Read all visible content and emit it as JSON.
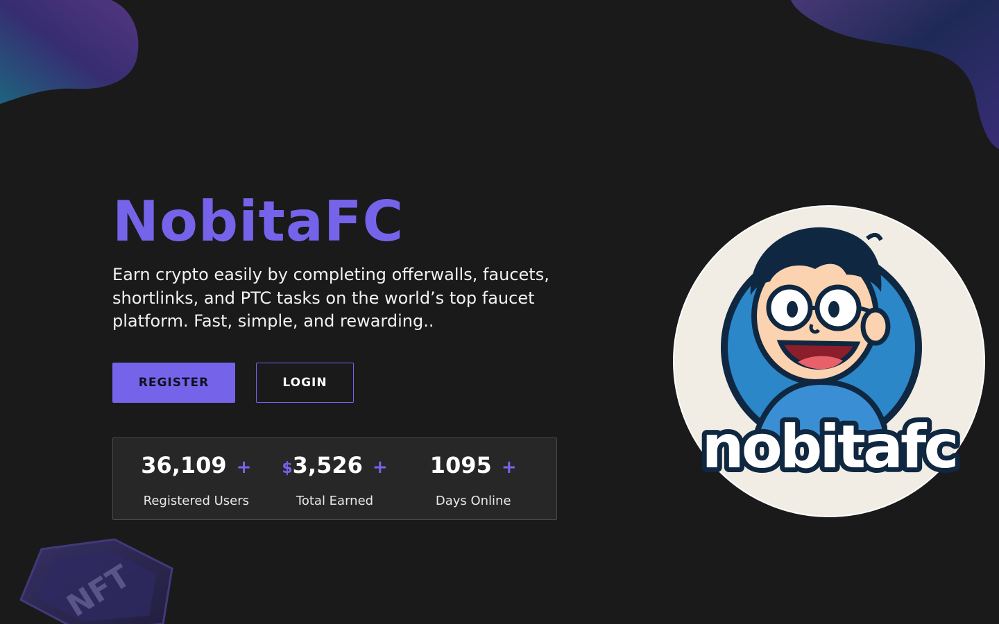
{
  "hero": {
    "title": "NobitaFC",
    "tagline": "Earn crypto easily by completing offerwalls, faucets, shortlinks, and PTC tasks on the world’s top faucet platform. Fast, simple, and rewarding.."
  },
  "buttons": {
    "register_label": "REGISTER",
    "login_label": "LOGIN"
  },
  "stats": [
    {
      "prefix": "",
      "value": "36,109",
      "suffix": "+",
      "label": "Registered Users"
    },
    {
      "prefix": "$",
      "value": "3,526",
      "suffix": "+",
      "label": "Total Earned"
    },
    {
      "prefix": "",
      "value": "1095",
      "suffix": "+",
      "label": "Days Online"
    }
  ],
  "logo": {
    "wordmark": "nobitafc"
  },
  "decor": {
    "badge_text": "NFT"
  },
  "colors": {
    "accent": "#7564ea",
    "background": "#1a1a1b",
    "panel": "#272728",
    "logo_bg": "#f1ece4",
    "logo_blue": "#2b87c8",
    "logo_navy": "#0f2740"
  }
}
